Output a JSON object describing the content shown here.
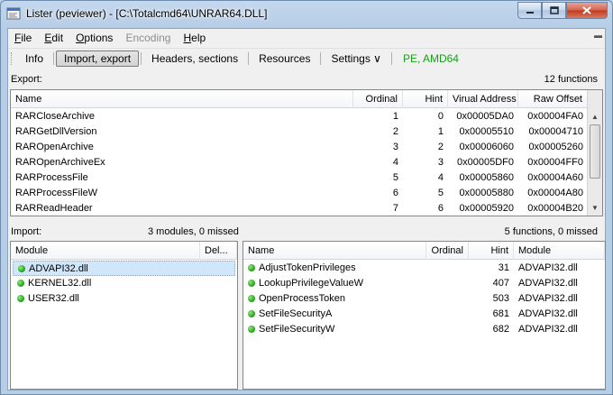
{
  "window": {
    "title": "Lister (peviewer) - [C:\\Totalcmd64\\UNRAR64.DLL]",
    "caption_buttons": [
      "minimize-icon",
      "maximize-icon",
      "close-icon"
    ]
  },
  "menu": [
    {
      "u": "F",
      "rest": "ile",
      "disabled": false
    },
    {
      "u": "E",
      "rest": "dit",
      "disabled": false
    },
    {
      "u": "O",
      "rest": "ptions",
      "disabled": false
    },
    {
      "u": "",
      "rest": "Encoding",
      "disabled": true
    },
    {
      "u": "H",
      "rest": "elp",
      "disabled": false
    }
  ],
  "toolbar": {
    "info": "Info",
    "import_export": "Import, export",
    "headers_sections": "Headers, sections",
    "resources": "Resources",
    "settings": "Settings ∨",
    "pe_type": "PE, AMD64"
  },
  "export": {
    "label": "Export:",
    "count": "12 functions",
    "columns": [
      "Name",
      "Ordinal",
      "Hint",
      "Virual Address",
      "Raw Offset"
    ],
    "rows": [
      [
        "RARCloseArchive",
        "1",
        "0",
        "0x00005DA0",
        "0x00004FA0"
      ],
      [
        "RARGetDllVersion",
        "2",
        "1",
        "0x00005510",
        "0x00004710"
      ],
      [
        "RAROpenArchive",
        "3",
        "2",
        "0x00006060",
        "0x00005260"
      ],
      [
        "RAROpenArchiveEx",
        "4",
        "3",
        "0x00005DF0",
        "0x00004FF0"
      ],
      [
        "RARProcessFile",
        "5",
        "4",
        "0x00005860",
        "0x00004A60"
      ],
      [
        "RARProcessFileW",
        "6",
        "5",
        "0x00005880",
        "0x00004A80"
      ],
      [
        "RARReadHeader",
        "7",
        "6",
        "0x00005920",
        "0x00004B20"
      ]
    ]
  },
  "import": {
    "label": "Import:",
    "modules_summary": "3 modules, 0 missed",
    "functions_summary": "5 functions, 0 missed",
    "module_columns": [
      "Module",
      "Del..."
    ],
    "modules": [
      "ADVAPI32.dll",
      "KERNEL32.dll",
      "USER32.dll"
    ],
    "function_columns": [
      "Name",
      "Ordinal",
      "Hint",
      "Module"
    ],
    "functions": [
      [
        "AdjustTokenPrivileges",
        "",
        "31",
        "ADVAPI32.dll"
      ],
      [
        "LookupPrivilegeValueW",
        "",
        "407",
        "ADVAPI32.dll"
      ],
      [
        "OpenProcessToken",
        "",
        "503",
        "ADVAPI32.dll"
      ],
      [
        "SetFileSecurityA",
        "",
        "681",
        "ADVAPI32.dll"
      ],
      [
        "SetFileSecurityW",
        "",
        "682",
        "ADVAPI32.dll"
      ]
    ]
  }
}
